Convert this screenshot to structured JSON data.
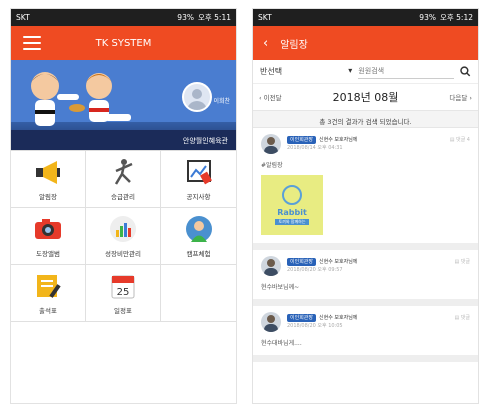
{
  "left": {
    "status": {
      "carrier": "SKT",
      "signal": "93%",
      "time": "오후 5:11"
    },
    "title": "TK SYSTEM",
    "banner": {
      "user_name": "이희찬",
      "school": "안양월인혜육관"
    },
    "menu": [
      {
        "label": "알림장",
        "icon": "megaphone-icon"
      },
      {
        "label": "승급관리",
        "icon": "martial-artist-icon"
      },
      {
        "label": "공지사항",
        "icon": "notice-board-icon"
      },
      {
        "label": "도장앨범",
        "icon": "camera-icon"
      },
      {
        "label": "성장비만관리",
        "icon": "growth-chart-icon"
      },
      {
        "label": "캠프체험",
        "icon": "camp-person-icon"
      },
      {
        "label": "출석표",
        "icon": "attendance-icon"
      },
      {
        "label": "일정표",
        "icon": "calendar-icon"
      }
    ],
    "calendar_day": "25"
  },
  "right": {
    "status": {
      "carrier": "SKT",
      "signal": "93%",
      "time": "오후 5:12"
    },
    "title": "알림장",
    "filter": {
      "select": "반선택",
      "search_placeholder": "원원검색"
    },
    "date_nav": {
      "prev": "이전달",
      "current": "2018년 08월",
      "next": "다음달"
    },
    "result_text": "총 3건의 결과가 검색 되었습니다.",
    "posts": [
      {
        "role": "이인희관장",
        "author": "신현수 보호자님께",
        "time": "2018/08/14 오후 04:31",
        "comments": "댓글 4",
        "text": "#알림장",
        "image_word": "Rabbit",
        "image_tag": "토끼와 함께하는"
      },
      {
        "role": "이인희관장",
        "author": "신현수 보호자님께",
        "time": "2018/08/20 오후 09:57",
        "comments": "댓글",
        "text": "현수바보님께~"
      },
      {
        "role": "이인희관장",
        "author": "신현수 보호자님께",
        "time": "2018/08/20 오후 10:05",
        "comments": "댓글",
        "text": "현수대바님게...."
      }
    ]
  }
}
